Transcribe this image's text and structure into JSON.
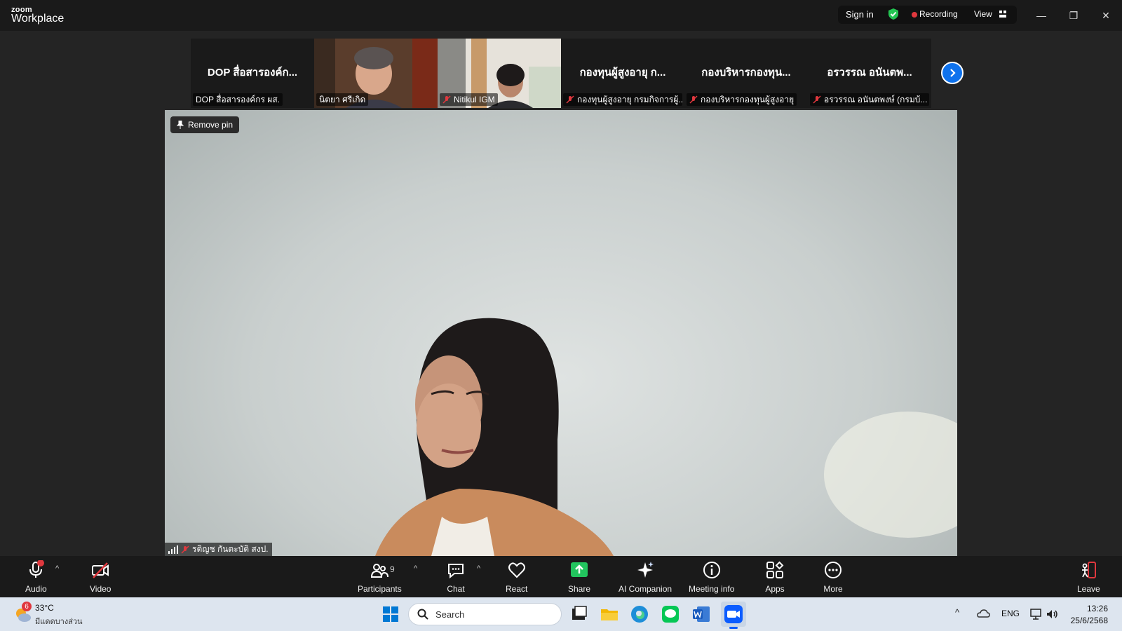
{
  "app": {
    "logo_small": "zoom",
    "logo_big": "Workplace",
    "sign_in": "Sign in",
    "recording": "Recording",
    "view": "View"
  },
  "gallery": {
    "tiles": [
      {
        "name": "DOP สื่อสารองค์ก...",
        "label": "DOP สื่อสารองค์กร ผส.",
        "muted": false,
        "video": false
      },
      {
        "name": "",
        "label": "นิตยา ศรีเกิด",
        "muted": false,
        "video": true
      },
      {
        "name": "",
        "label": "Nitikul IGM",
        "muted": true,
        "video": true
      },
      {
        "name": "กองทุนผู้สูงอายุ ก...",
        "label": "กองทุนผู้สูงอายุ กรมกิจการผู้...",
        "muted": true,
        "video": false
      },
      {
        "name": "กองบริหารกองทุน...",
        "label": "กองบริหารกองทุนผู้สูงอายุ",
        "muted": true,
        "video": false
      },
      {
        "name": "อรวรรณ อนันตพ...",
        "label": "อรวรรณ อนันตพงษ์ (กรมบ้...",
        "muted": true,
        "video": false
      }
    ]
  },
  "main": {
    "remove_pin": "Remove pin",
    "speaker": "รติญช กันตะบัติ สงป."
  },
  "toolbar": {
    "audio": "Audio",
    "video": "Video",
    "participants": "Participants",
    "participants_count": "9",
    "chat": "Chat",
    "react": "React",
    "share": "Share",
    "ai": "AI Companion",
    "info": "Meeting info",
    "apps": "Apps",
    "more": "More",
    "leave": "Leave",
    "share_color": "#22c55e",
    "leave_color": "#e0383e"
  },
  "taskbar": {
    "weather_badge": "6",
    "temp": "33°C",
    "weather_desc": "มีแดดบางส่วน",
    "search": "Search",
    "lang": "ENG",
    "time": "13:26",
    "date": "25/6/2568"
  }
}
